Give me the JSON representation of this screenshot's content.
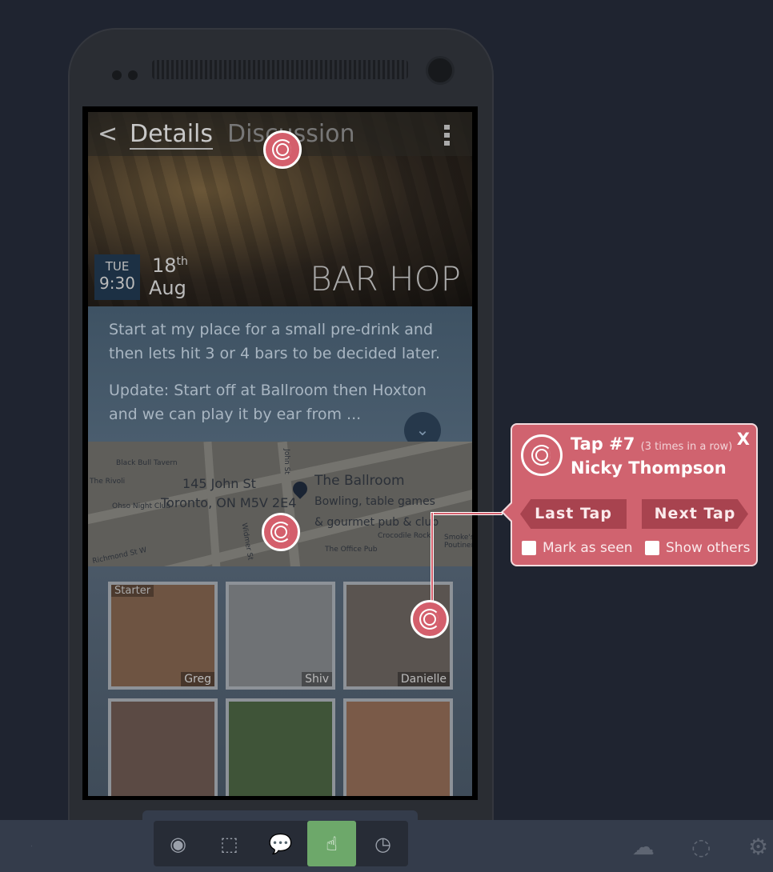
{
  "app": {
    "nav": {
      "back": "<",
      "tabs": [
        "Details",
        "Discussion"
      ]
    },
    "event": {
      "weekday": "TUE",
      "time": "9:30",
      "day": "18",
      "day_suffix": "th",
      "month": "Aug",
      "title": "BAR HOP",
      "description": [
        "Start at my place for a small pre-drink and then lets hit 3 or 4 bars to be decided later.",
        "Update: Start off at Ballroom then Hoxton and we can play it by ear from ..."
      ]
    },
    "map": {
      "address_line1": "145 John St",
      "address_line2": "Toronto, ON M5V 2E4",
      "venue": "The Ballroom",
      "venue_desc1": "Bowling, table games",
      "venue_desc2": "& gourmet pub & club",
      "labels": [
        "Black Bull Tavern",
        "The Rivoli",
        "Ohso Night Club",
        "Richmond St W",
        "John St",
        "Widmer St",
        "Crocodile Rock",
        "The Office Pub",
        "Smoke's Poutinerie"
      ]
    },
    "people": [
      {
        "name": "Greg",
        "badge": "Starter"
      },
      {
        "name": "Shiv"
      },
      {
        "name": "Danielle"
      },
      {
        "name": ""
      },
      {
        "name": ""
      },
      {
        "name": ""
      }
    ]
  },
  "popup": {
    "tap": "Tap #7",
    "tap_note": "(3 times in a row)",
    "user": "Nicky Thompson",
    "close": "X",
    "last": "Last Tap",
    "next": "Next Tap",
    "mark_seen": "Mark as seen",
    "show_others": "Show others",
    "color": "#d0636f"
  },
  "toolbar": {
    "tools": [
      {
        "icon": "eye-icon",
        "glyph": "◉"
      },
      {
        "icon": "select-area-icon",
        "glyph": "⬚"
      },
      {
        "icon": "comment-icon",
        "glyph": "💬"
      },
      {
        "icon": "fingerprint-icon",
        "glyph": "☝",
        "active": true
      },
      {
        "icon": "clock-icon",
        "glyph": "◷"
      }
    ],
    "right": [
      {
        "icon": "cloud-upload-icon",
        "glyph": "☁"
      },
      {
        "icon": "dashed-circle-icon",
        "glyph": "◌"
      },
      {
        "icon": "gear-icon",
        "glyph": "⚙"
      }
    ],
    "active_color": "#6da86a"
  }
}
